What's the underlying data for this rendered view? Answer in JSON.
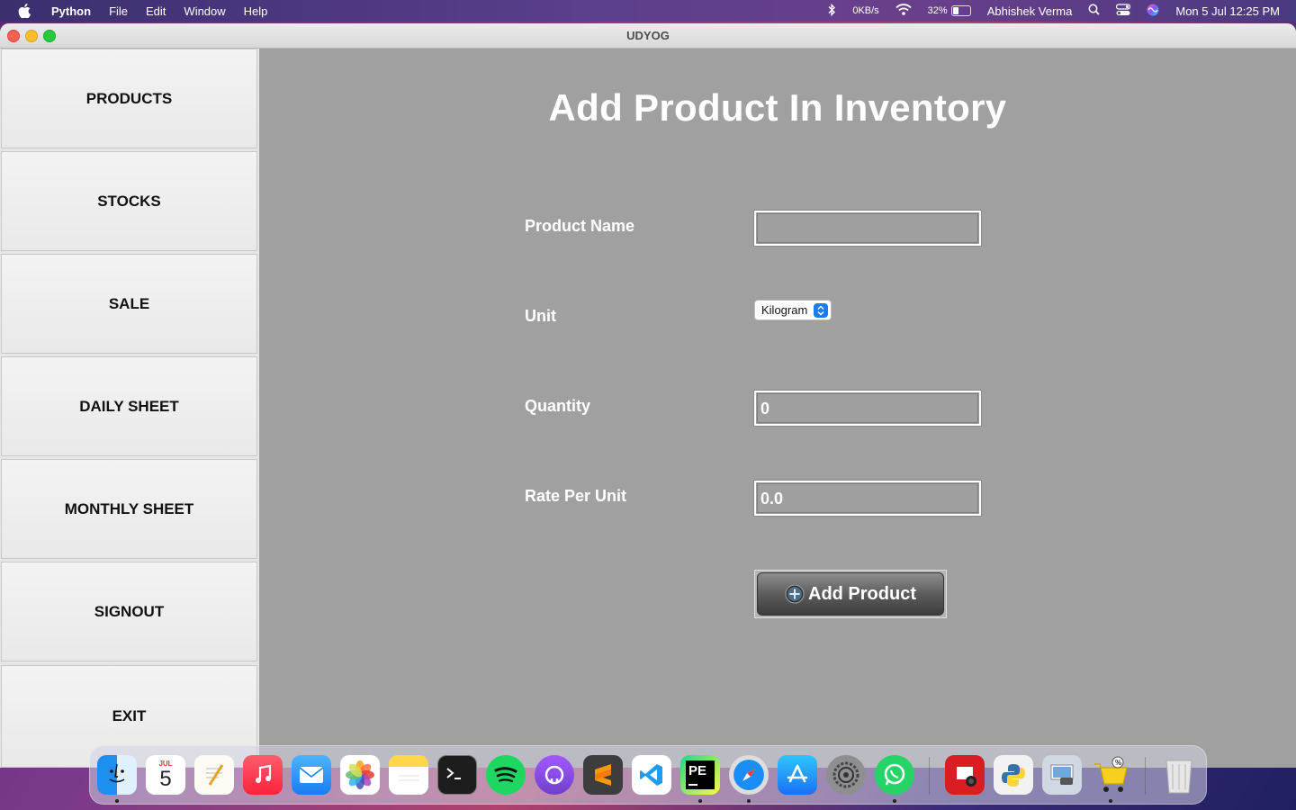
{
  "menubar": {
    "app_name": "Python",
    "menus": [
      "File",
      "Edit",
      "Window",
      "Help"
    ],
    "network_speed": "0KB/s",
    "battery_percent": "32%",
    "battery_level": 0.32,
    "user_name": "Abhishek Verma",
    "datetime": "Mon 5 Jul  12:25 PM"
  },
  "window": {
    "title": "UDYOG"
  },
  "sidebar": {
    "items": [
      {
        "label": "PRODUCTS"
      },
      {
        "label": "STOCKS"
      },
      {
        "label": "SALE"
      },
      {
        "label": "DAILY SHEET"
      },
      {
        "label": "MONTHLY SHEET"
      },
      {
        "label": "SIGNOUT"
      },
      {
        "label": "EXIT"
      }
    ]
  },
  "form": {
    "title": "Add Product In Inventory",
    "product_name_label": "Product Name",
    "product_name_value": "",
    "unit_label": "Unit",
    "unit_selected": "Kilogram",
    "quantity_label": "Quantity",
    "quantity_value": "0",
    "rate_label": "Rate Per Unit",
    "rate_value": "0.0",
    "submit_label": "Add Product"
  },
  "dock": {
    "calendar_month": "JUL",
    "calendar_day": "5",
    "apps": [
      "finder-icon",
      "calendar-icon",
      "textedit-icon",
      "music-icon",
      "mail-icon",
      "photos-icon",
      "notes-icon",
      "terminal-icon",
      "spotify-icon",
      "github-desktop-icon",
      "sublime-text-icon",
      "vscode-icon",
      "pycharm-icon",
      "safari-icon",
      "app-store-icon",
      "system-preferences-icon",
      "whatsapp-icon",
      "photo-booth-icon",
      "python-launcher-icon",
      "preview-icon",
      "shopping-cart-icon",
      "trash-icon"
    ],
    "pycharm_text": "PE"
  }
}
